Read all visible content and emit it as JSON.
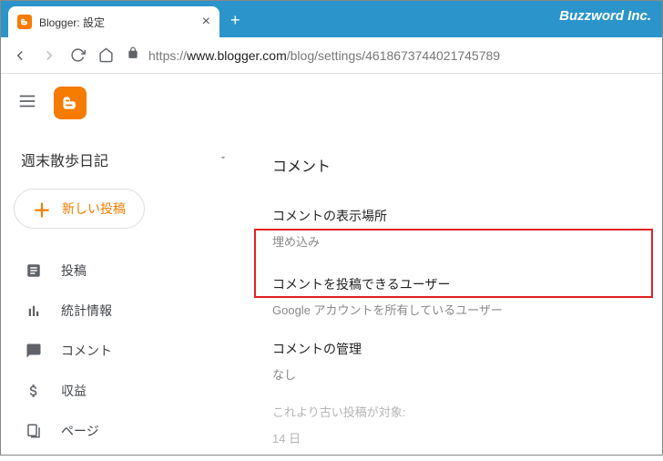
{
  "browser": {
    "tab_title": "Blogger: 設定",
    "brand": "Buzzword Inc.",
    "url_prefix": "https://",
    "url_host": "www.blogger.com",
    "url_path": "/blog/settings/4618673744021745789"
  },
  "sidebar": {
    "blog_name": "週末散歩日記",
    "new_post_label": "新しい投稿",
    "items": [
      {
        "label": "投稿"
      },
      {
        "label": "統計情報"
      },
      {
        "label": "コメント"
      },
      {
        "label": "収益"
      },
      {
        "label": "ページ"
      }
    ]
  },
  "content": {
    "section_title": "コメント",
    "settings": [
      {
        "label": "コメントの表示場所",
        "value": "埋め込み"
      },
      {
        "label": "コメントを投稿できるユーザー",
        "value": "Google アカウントを所有しているユーザー"
      },
      {
        "label": "コメントの管理",
        "value": "なし"
      },
      {
        "label": "これより古い投稿が対象:",
        "value": "14 日"
      }
    ]
  }
}
